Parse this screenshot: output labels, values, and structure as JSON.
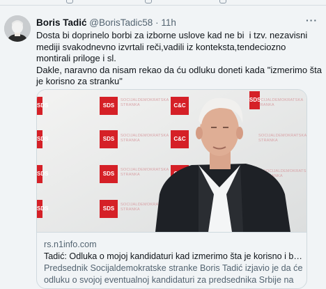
{
  "tweet": {
    "author_name": "Boris Tadić",
    "author_handle": "@BorisTadic58",
    "separator": "·",
    "time": "11h",
    "more_icon": "ellipsis-icon",
    "body_lines": [
      "Dosta bi doprinelo borbi za izborne uslove kad ne bi  i tzv. nezavisni mediji svakodnevno izvrtali reči,vadili iz konteksta,tendeciozno montirali priloge i sl.",
      "Dakle, naravno da nisam rekao da ću odluku doneti kada \"izmerimo šta je korisno za stranku\""
    ]
  },
  "card": {
    "domain": "rs.n1info.com",
    "title": "Tadić: Odluka o mojoj kandidaturi kad izmerimo šta je korisno i bitno z...",
    "description": "Predsednik Socijaldemokratske stranke Boris Tadić izjavio je da će odluku o svojoj eventualnoj kandidaturi za predsednika Srbije na ...",
    "backdrop_logo_text": "SDS",
    "backdrop_logo_text_alt": "C&C",
    "backdrop_caption": "SOCIJALDEMOKRATSKA STRANKA",
    "brand_color": "#d52027"
  }
}
